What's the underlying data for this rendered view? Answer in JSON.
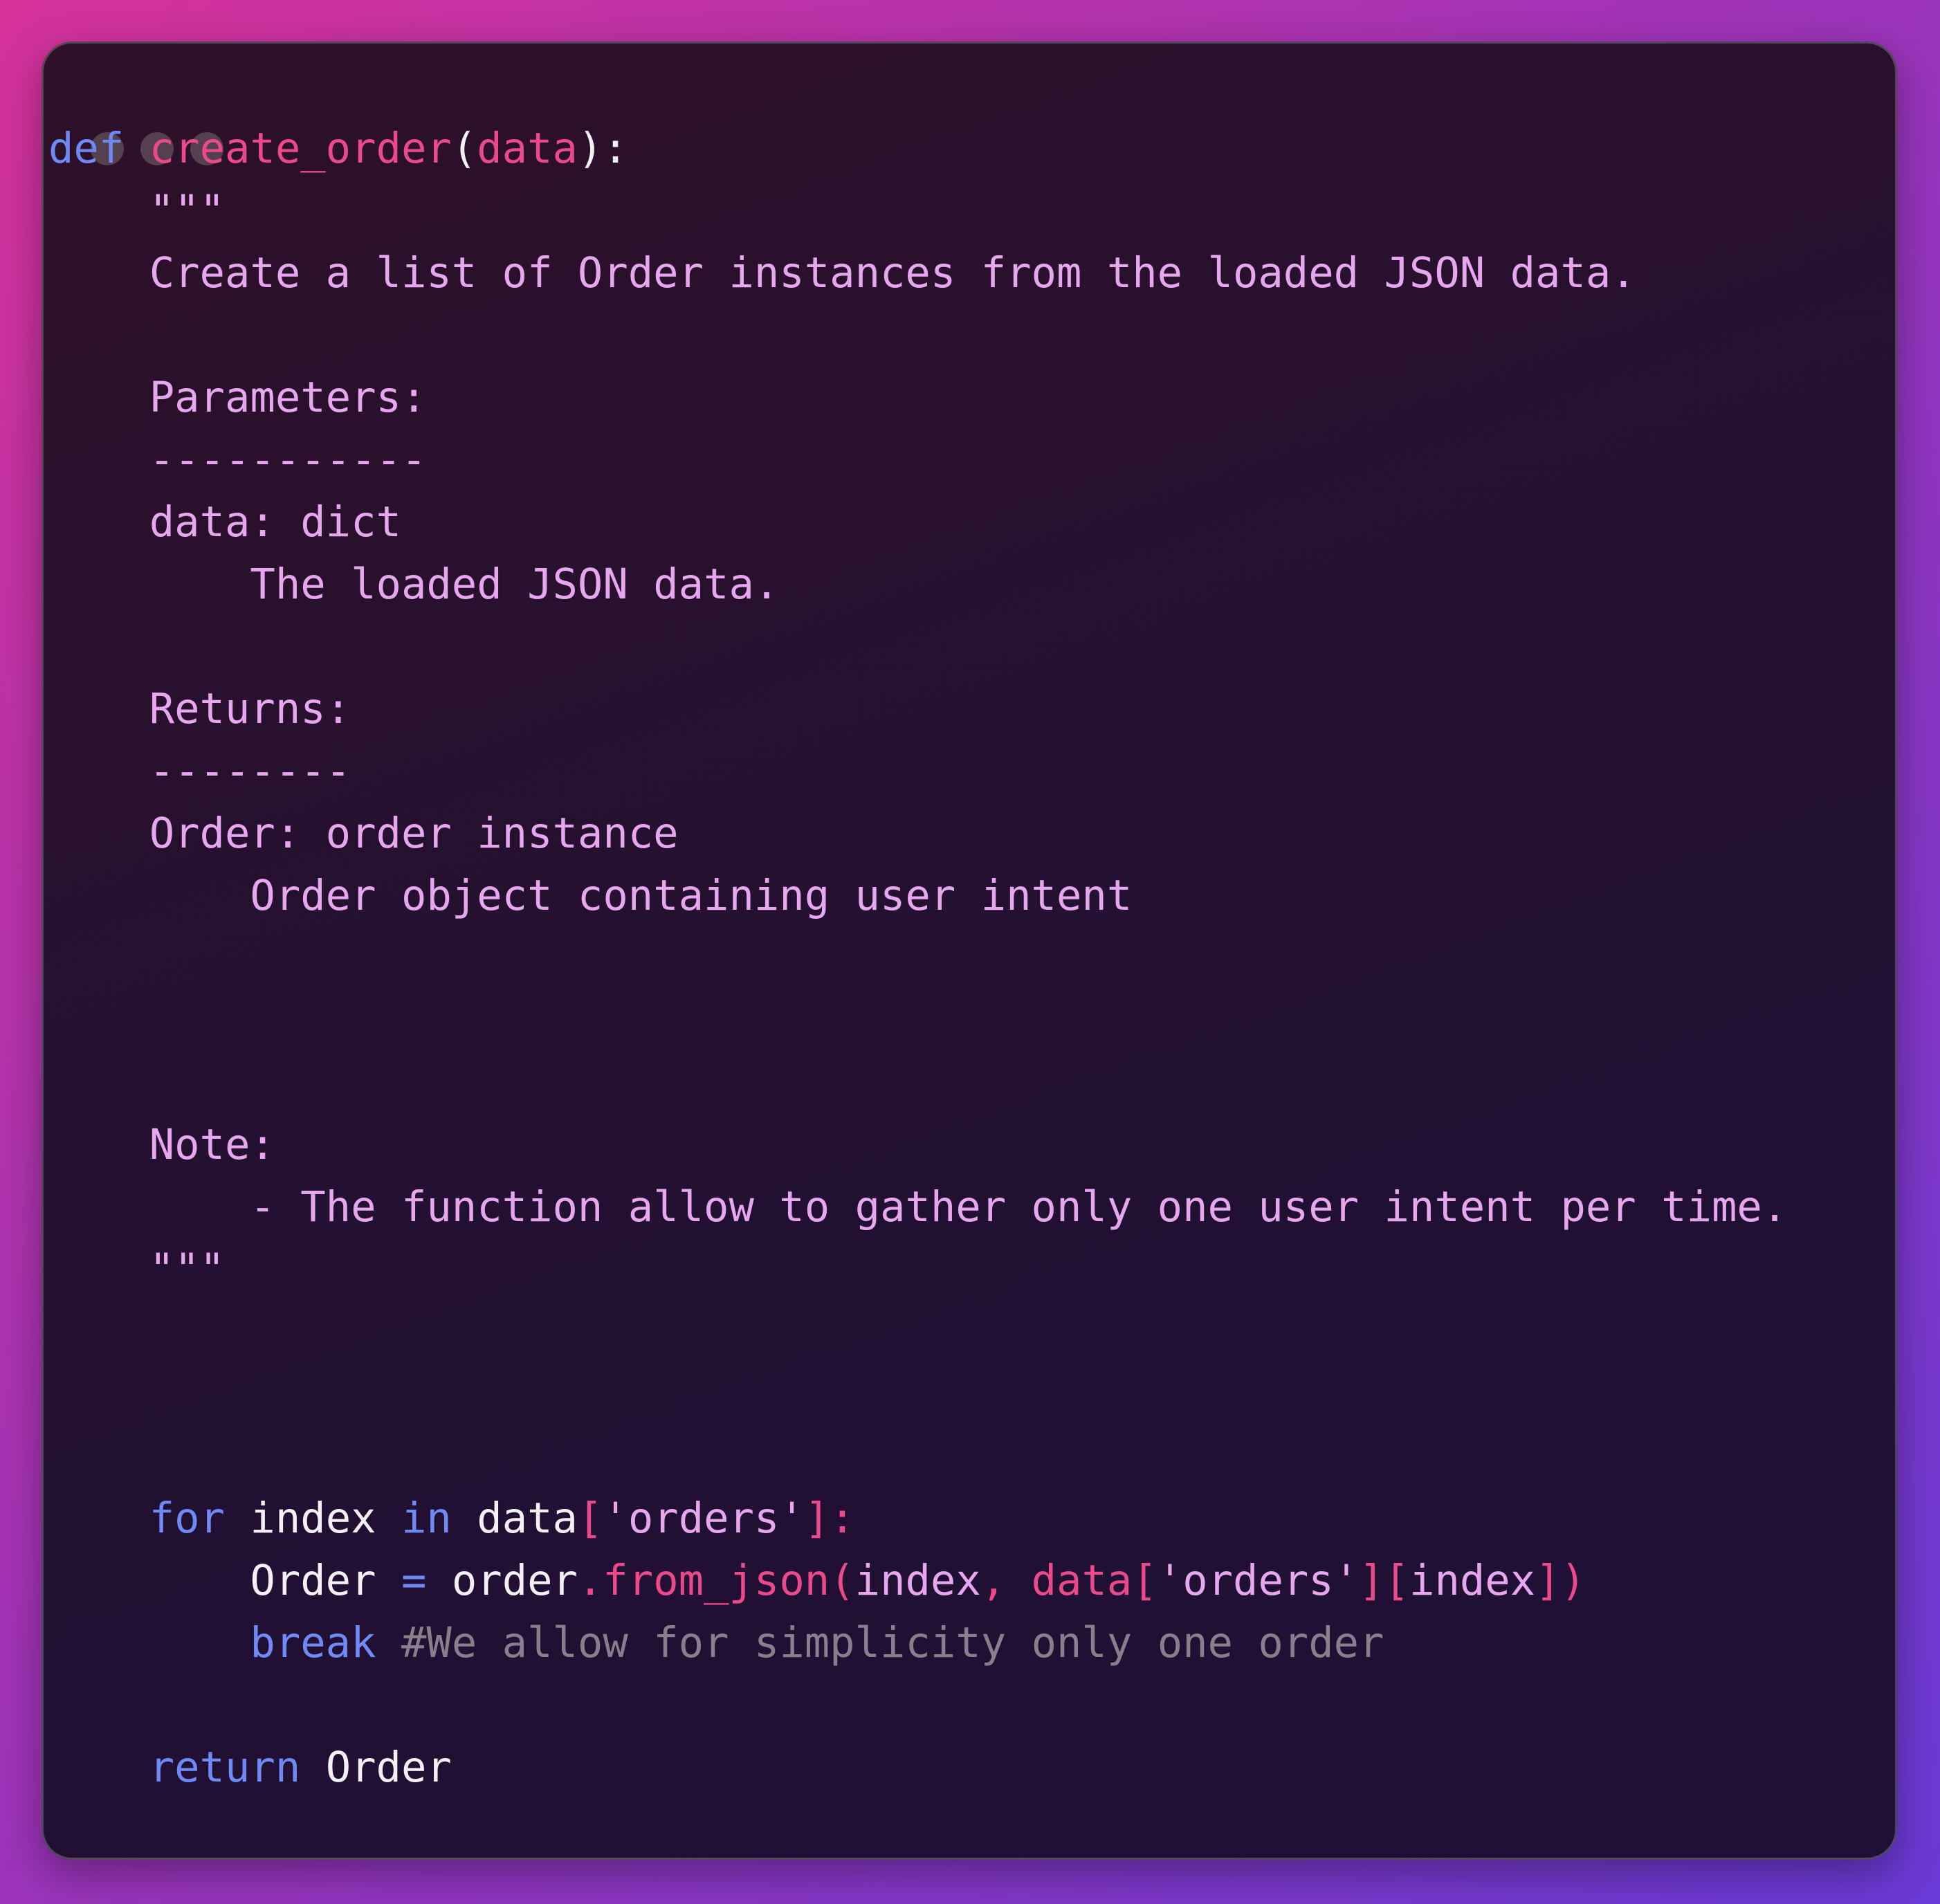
{
  "window": {
    "title_dots": [
      "close",
      "minimize",
      "maximize"
    ],
    "colors": {
      "keyword": "#6f8af5",
      "function": "#ea4a8a",
      "docstring": "#e6a7ef",
      "identifier": "#f4f1f6",
      "comment": "#8c7d8c",
      "window_dot": "#54404f"
    }
  },
  "code": {
    "line1": {
      "def": "def",
      "name": "create_order",
      "open": "(",
      "param": "data",
      "close": "):"
    },
    "line2": {
      "quotes": "\"\"\""
    },
    "line3": {
      "text": "Create a list of Order instances from the loaded JSON data."
    },
    "line5": {
      "text": "Parameters:"
    },
    "line6": {
      "text": "-----------"
    },
    "line7": {
      "text": "data: dict"
    },
    "line8": {
      "text": "The loaded JSON data."
    },
    "line10": {
      "text": "Returns:"
    },
    "line11": {
      "text": "--------"
    },
    "line12": {
      "text": "Order: order instance"
    },
    "line13": {
      "text": "Order object containing user intent"
    },
    "line17": {
      "text": "Note:"
    },
    "line18": {
      "text": "- The function allow to gather only one user intent per time."
    },
    "line19": {
      "quotes": "\"\"\""
    },
    "line23": {
      "for": "for",
      "index": "index",
      "in": "in",
      "data": "data",
      "bracket_open": "[",
      "key": "'orders'",
      "bracket_close": "]:"
    },
    "line24": {
      "Order": "Order",
      "eq": "=",
      "obj": "order",
      "method": ".from_json(",
      "arg1": "index",
      "comma": ", ",
      "data": "data",
      "bracket_open": "[",
      "key": "'orders'",
      "middle": "][",
      "arg2": "index",
      "end": "])"
    },
    "line25": {
      "break": "break",
      "comment": "#We allow for simplicity only one order"
    },
    "line27": {
      "return": "return",
      "value": "Order"
    }
  }
}
